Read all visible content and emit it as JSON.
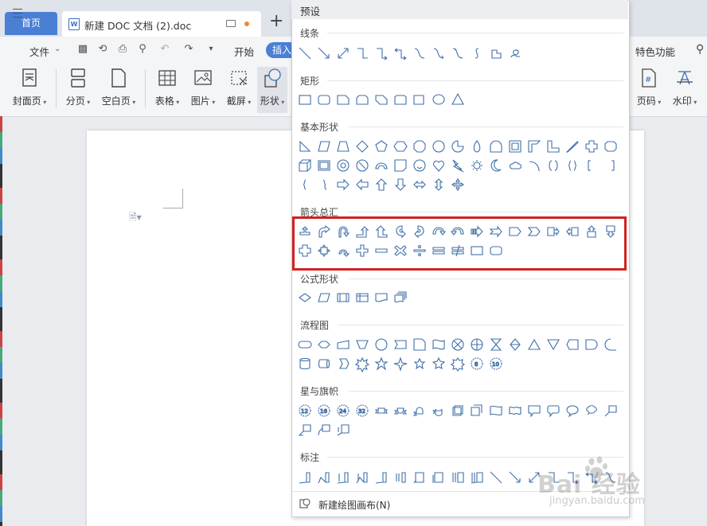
{
  "tabs": {
    "home_label": "首页",
    "doc_title": "新建 DOC 文档 (2).doc",
    "add_label": "+"
  },
  "menu": {
    "file_label": "文件",
    "start_label": "开始",
    "insert_label": "插入",
    "special_label": "特色功能"
  },
  "toolbar": [
    {
      "label": "封面页",
      "icon": "cover-page-icon"
    },
    {
      "label": "分页",
      "icon": "page-break-icon"
    },
    {
      "label": "空白页",
      "icon": "blank-page-icon"
    },
    {
      "label": "表格",
      "icon": "table-icon"
    },
    {
      "label": "图片",
      "icon": "picture-icon"
    },
    {
      "label": "截屏",
      "icon": "screenshot-icon"
    },
    {
      "label": "形状",
      "icon": "shape-icon"
    },
    {
      "label": "页码",
      "icon": "page-number-icon"
    },
    {
      "label": "水印",
      "icon": "watermark-icon"
    }
  ],
  "panel": {
    "title": "预设",
    "sections": [
      {
        "label": "线条",
        "rows": [
          12
        ]
      },
      {
        "label": "矩形",
        "rows": [
          9
        ]
      },
      {
        "label": "基本形状",
        "rows": [
          17,
          17,
          9
        ]
      },
      {
        "label": "箭头总汇",
        "rows": [
          17,
          11
        ]
      },
      {
        "label": "公式形状",
        "rows": [
          6
        ]
      },
      {
        "label": "流程图",
        "rows": [
          17,
          11
        ]
      },
      {
        "label": "星与旗帜",
        "rows": [
          17,
          3
        ]
      },
      {
        "label": "标注",
        "rows": [
          17
        ]
      }
    ],
    "highlighted_section": "箭头总汇",
    "footer_label": "新建绘图画布(N)"
  },
  "watermark": {
    "brand": "Bai 经验",
    "url": "jingyan.baidu.com"
  },
  "colors": {
    "accent": "#4a7fd4",
    "shape_stroke": "#3f6fa9",
    "highlight": "#d32020"
  }
}
